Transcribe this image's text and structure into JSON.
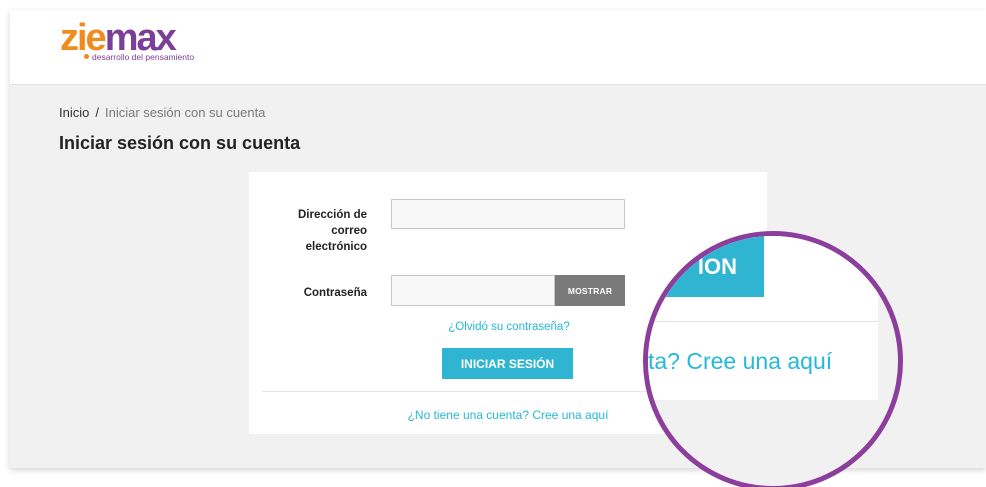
{
  "logo": {
    "main_orange": "zie",
    "main_purple": "max",
    "tagline": "desarrollo del pensamiento"
  },
  "breadcrumb": {
    "home": "Inicio",
    "separator": "/",
    "current": "Iniciar sesión con su cuenta"
  },
  "page": {
    "title": "Iniciar sesión con su cuenta"
  },
  "form": {
    "email_label": "Dirección de correo electrónico",
    "email_value": "",
    "password_label": "Contraseña",
    "password_value": "",
    "show_label": "MOSTRAR",
    "forgot_label": "¿Olvidó su contraseña?",
    "submit_label": "INICIAR SESIÓN",
    "create_account_label": "¿No tiene una cuenta? Cree una aquí"
  },
  "magnifier": {
    "button_fragment": "ION",
    "text_fragment": "ta? Cree una aquí"
  },
  "colors": {
    "accent": "#2fb5d2",
    "link": "#24b9d7",
    "magnifier_ring": "#8c3e9c",
    "logo_orange": "#f18b1d",
    "logo_purple": "#7b3f98"
  }
}
